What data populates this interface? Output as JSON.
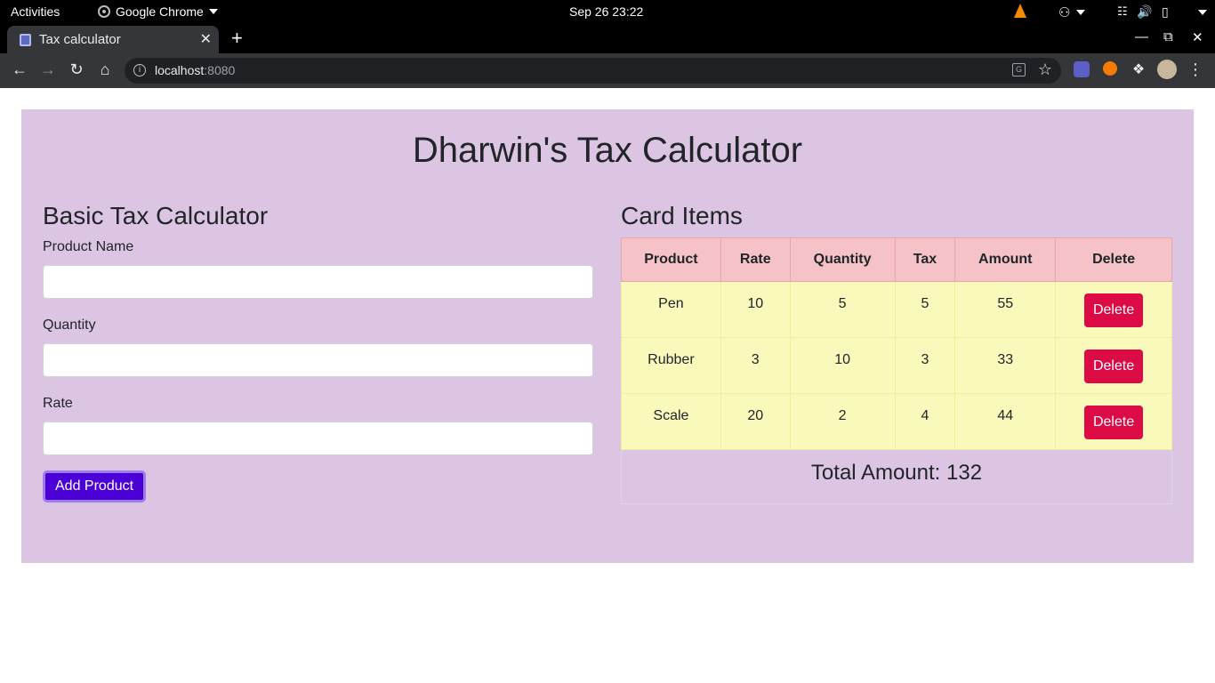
{
  "system_bar": {
    "activities": "Activities",
    "app_name": "Google Chrome",
    "clock": "Sep 26  23:22"
  },
  "browser": {
    "tab_title": "Tax calculator",
    "url_host": "localhost",
    "url_port": ":8080"
  },
  "page": {
    "title": "Dharwin's Tax Calculator",
    "form": {
      "heading": "Basic Tax Calculator",
      "product_label": "Product Name",
      "product_value": "",
      "quantity_label": "Quantity",
      "quantity_value": "",
      "rate_label": "Rate",
      "rate_value": "",
      "add_button": "Add Product"
    },
    "cart": {
      "heading": "Card Items",
      "columns": [
        "Product",
        "Rate",
        "Quantity",
        "Tax",
        "Amount",
        "Delete"
      ],
      "rows": [
        {
          "product": "Pen",
          "rate": "10",
          "quantity": "5",
          "tax": "5",
          "amount": "55",
          "delete": "Delete"
        },
        {
          "product": "Rubber",
          "rate": "3",
          "quantity": "10",
          "tax": "3",
          "amount": "33",
          "delete": "Delete"
        },
        {
          "product": "Scale",
          "rate": "20",
          "quantity": "2",
          "tax": "4",
          "amount": "44",
          "delete": "Delete"
        }
      ],
      "total_text": "Total Amount: 132"
    }
  }
}
